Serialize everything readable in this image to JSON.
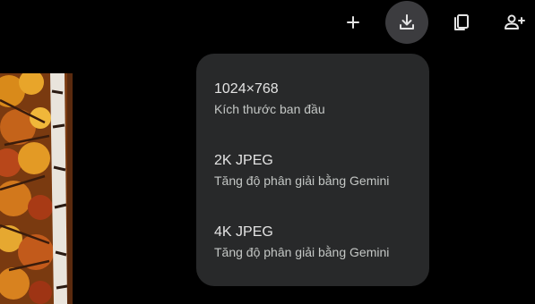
{
  "toolbar": {
    "add_icon": "plus-icon",
    "download_icon": "download-icon",
    "copy_icon": "copy-icon",
    "share_icon": "add-person-icon"
  },
  "menu": {
    "items": [
      {
        "title": "1024×768",
        "subtitle": "Kích thước ban đầu"
      },
      {
        "title": "2K JPEG",
        "subtitle": "Tăng độ phân giải bằng Gemini"
      },
      {
        "title": "4K JPEG",
        "subtitle": "Tăng độ phân giải bằng Gemini"
      }
    ]
  },
  "colors": {
    "background": "#000000",
    "menu_background": "#28292a",
    "active_button": "#3c3c3f",
    "title_text": "#e3e3e3",
    "subtitle_text": "#c4c7c5"
  }
}
